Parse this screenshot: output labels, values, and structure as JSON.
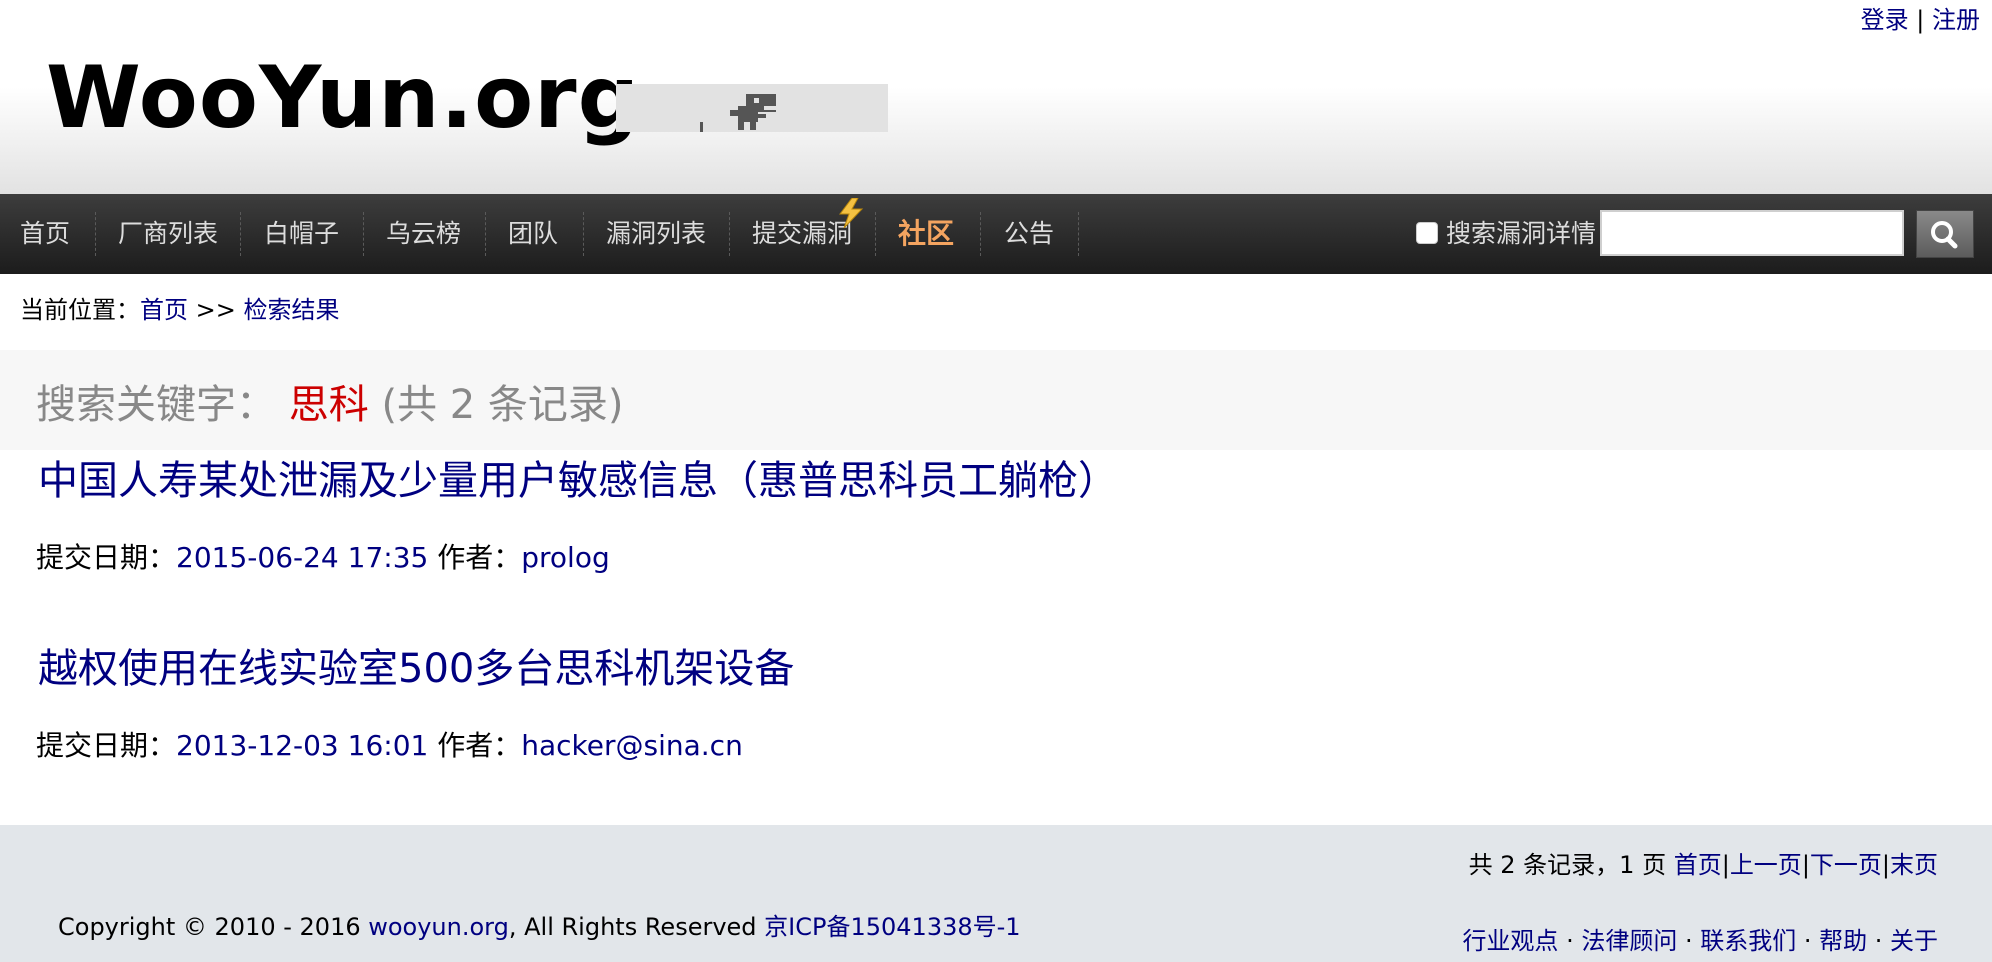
{
  "header": {
    "login": "登录",
    "separator": "|",
    "register": "注册",
    "logo": "WooYun.org"
  },
  "nav": {
    "items": [
      "首页",
      "厂商列表",
      "白帽子",
      "乌云榜",
      "团队",
      "漏洞列表",
      "提交漏洞",
      "社区",
      "公告"
    ],
    "active_index": 7,
    "search_label": "搜索漏洞详情",
    "search_value": ""
  },
  "breadcrumb": {
    "prefix": "当前位置：",
    "home": "首页",
    "sep": " >> ",
    "current": "检索结果"
  },
  "search": {
    "label": "搜索关键字：",
    "keyword": "思科",
    "count_text": "(共 2 条记录)"
  },
  "results": [
    {
      "title": "中国人寿某处泄漏及少量用户敏感信息（惠普思科员工躺枪）",
      "date_label": "提交日期：",
      "date": "2015-06-24 17:35",
      "author_label": " 作者：",
      "author": "prolog"
    },
    {
      "title": "越权使用在线实验室500多台思科机架设备",
      "date_label": "提交日期：",
      "date": "2013-12-03 16:01",
      "author_label": " 作者：",
      "author": "hacker@sina.cn"
    }
  ],
  "pager": {
    "summary": "共 2 条记录，1 页 ",
    "first": "首页",
    "prev": "上一页",
    "next": "下一页",
    "last": "末页",
    "divider": "|"
  },
  "footer": {
    "copyright_prefix": "Copyright © 2010 - 2016 ",
    "site": "wooyun.org",
    "rights": ", All Rights Reserved ",
    "icp": "京ICP备15041338号-1",
    "links": [
      "行业观点",
      "法律顾问",
      "联系我们",
      "帮助",
      "关于"
    ],
    "dot": " · "
  },
  "colors": {
    "link": "#000080",
    "keyword": "#cc0000",
    "nav_active": "#f4a460",
    "nav_bg": "#2a2a2a",
    "footer_bg": "#e2e6ea"
  }
}
